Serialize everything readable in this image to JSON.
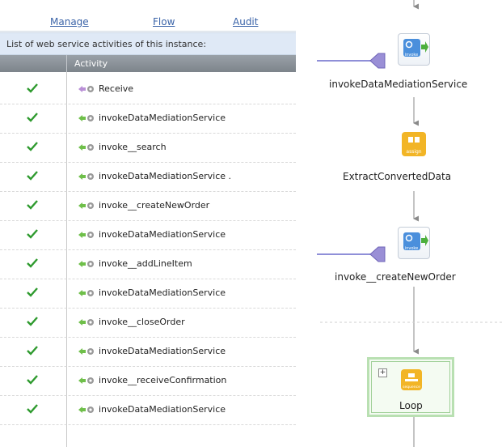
{
  "nav": {
    "manage": "Manage",
    "flow": "Flow",
    "audit": "Audit"
  },
  "caption": "List of web service activities of this instance:",
  "table": {
    "header": "Activity",
    "rows": [
      {
        "status": "done",
        "activity": "Receive"
      },
      {
        "status": "done",
        "activity": "invokeDataMediationService"
      },
      {
        "status": "done",
        "activity": "invoke__search"
      },
      {
        "status": "done",
        "activity": "invokeDataMediationService ."
      },
      {
        "status": "done",
        "activity": "invoke__createNewOrder"
      },
      {
        "status": "done",
        "activity": "invokeDataMediationService"
      },
      {
        "status": "done",
        "activity": "invoke__addLineItem"
      },
      {
        "status": "done",
        "activity": "invokeDataMediationService"
      },
      {
        "status": "done",
        "activity": "invoke__closeOrder"
      },
      {
        "status": "done",
        "activity": "invokeDataMediationService"
      },
      {
        "status": "done",
        "activity": "invoke__receiveConfirmation"
      },
      {
        "status": "done",
        "activity": "invokeDataMediationService"
      }
    ]
  },
  "flow": {
    "nodes": [
      {
        "label": "invokeDataMediationService",
        "type": "invoke",
        "icon_text": "invoke"
      },
      {
        "label": "ExtractConvertedData",
        "type": "assign",
        "icon_text": "assign"
      },
      {
        "label": "invoke__createNewOrder",
        "type": "invoke",
        "icon_text": "invoke"
      },
      {
        "label": "Loop",
        "type": "sequence",
        "icon_text": "sequence",
        "expand": "+"
      }
    ]
  },
  "colors": {
    "check": "#2e9a2e",
    "invoke_node": "#4a8fdc",
    "assign_node": "#f2b526",
    "loop_border": "#b9e0b2",
    "nav_link": "#3a63a8",
    "caption_bg": "#dfe9f6"
  }
}
